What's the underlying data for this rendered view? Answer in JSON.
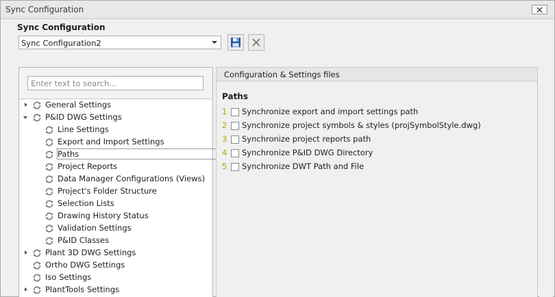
{
  "window": {
    "title": "Sync Configuration",
    "close_icon": "close-x-icon"
  },
  "config": {
    "label": "Sync Configuration",
    "selected": "Sync Configuration2",
    "save_icon": "floppy-disk-icon",
    "delete_icon": "delete-x-icon",
    "save_color": "#2457a8"
  },
  "search": {
    "placeholder": "Enter text to search..."
  },
  "tree": {
    "nodes": [
      {
        "label": "General Settings",
        "level": 0,
        "expander": "collapsed",
        "icon": "sync-icon"
      },
      {
        "label": "P&ID DWG Settings",
        "level": 0,
        "expander": "expanded",
        "icon": "sync-icon"
      },
      {
        "label": "Line Settings",
        "level": 1,
        "expander": "none",
        "icon": "sync-icon"
      },
      {
        "label": "Export and Import Settings",
        "level": 1,
        "expander": "none",
        "icon": "sync-icon"
      },
      {
        "label": "Paths",
        "level": 1,
        "expander": "none",
        "icon": "sync-icon",
        "selected": true
      },
      {
        "label": "Project Reports",
        "level": 1,
        "expander": "none",
        "icon": "sync-icon"
      },
      {
        "label": "Data Manager Configurations (Views)",
        "level": 1,
        "expander": "none",
        "icon": "sync-icon"
      },
      {
        "label": "Project's Folder Structure",
        "level": 1,
        "expander": "none",
        "icon": "sync-icon"
      },
      {
        "label": "Selection Lists",
        "level": 1,
        "expander": "none",
        "icon": "sync-icon"
      },
      {
        "label": "Drawing History Status",
        "level": 1,
        "expander": "none",
        "icon": "sync-icon"
      },
      {
        "label": "Validation Settings",
        "level": 1,
        "expander": "none",
        "icon": "sync-icon"
      },
      {
        "label": "P&ID Classes",
        "level": 1,
        "expander": "none",
        "icon": "sync-icon"
      },
      {
        "label": "Plant 3D DWG Settings",
        "level": 0,
        "expander": "collapsed",
        "icon": "sync-icon"
      },
      {
        "label": "Ortho DWG Settings",
        "level": 0,
        "expander": "none",
        "icon": "sync-icon"
      },
      {
        "label": "Iso Settings",
        "level": 0,
        "expander": "none",
        "icon": "sync-icon"
      },
      {
        "label": "PlantTools Settings",
        "level": 0,
        "expander": "collapsed",
        "icon": "sync-icon"
      }
    ]
  },
  "right_panel": {
    "header": "Configuration & Settings files",
    "section_title": "Paths",
    "number_color": "#b8a000",
    "options": [
      {
        "num": "1",
        "label": "Synchronize export and import settings path",
        "checked": false
      },
      {
        "num": "2",
        "label": "Synchronize project symbols & styles (projSymbolStyle.dwg)",
        "checked": false
      },
      {
        "num": "3",
        "label": "Synchronize project reports path",
        "checked": false
      },
      {
        "num": "4",
        "label": "Synchronize P&ID DWG Directory",
        "checked": false
      },
      {
        "num": "5",
        "label": "Synchronize DWT Path and File",
        "checked": false
      }
    ]
  }
}
